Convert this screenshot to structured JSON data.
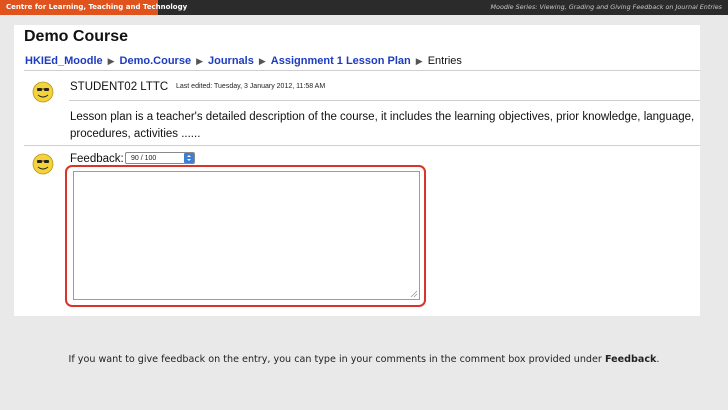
{
  "header": {
    "left_title": "Centre for Learning, Teaching and Technology",
    "right_title": "Moodle Series: Viewing, Grading and Giving Feedback on Journal Entries",
    "accent_color": "#e0531c"
  },
  "page": {
    "course_title": "Demo Course",
    "breadcrumb": [
      {
        "label": "HKIEd_Moodle",
        "link": true
      },
      {
        "label": "Demo.Course",
        "link": true
      },
      {
        "label": "Journals",
        "link": true
      },
      {
        "label": "Assignment 1 Lesson Plan",
        "link": true
      },
      {
        "label": "Entries",
        "link": false
      }
    ]
  },
  "entry": {
    "student_name": "STUDENT02 LTTC",
    "last_edited": "Last edited: Tuesday, 3 January 2012, 11:58 AM",
    "text": "Lesson plan is a teacher's detailed description of the course, it includes the learning objectives, prior knowledge, language, procedures, activities ......"
  },
  "feedback": {
    "label": "Feedback:",
    "grade_value": "90 / 100",
    "comment_value": "",
    "highlight_color": "#d9342b"
  },
  "caption": {
    "text_before": "If you want to give feedback on the entry, you can type in your comments in the comment box provided under ",
    "bold": "Feedback",
    "text_after": "."
  }
}
